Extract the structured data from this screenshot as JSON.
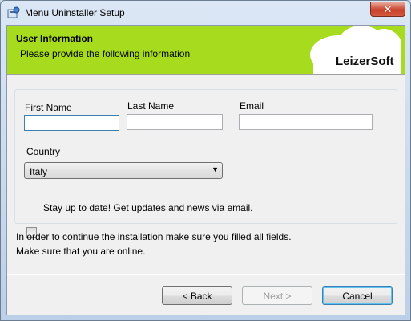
{
  "window": {
    "title": "Menu Uninstaller Setup",
    "close_glyph": "✕"
  },
  "banner": {
    "title": "User Information",
    "subtitle": "Please provide the following information",
    "logo": "LeizerSoft",
    "background_color": "#a6dc1d"
  },
  "form": {
    "first_name_label": "First Name",
    "first_name_value": "",
    "last_name_label": "Last Name",
    "last_name_value": "",
    "email_label": "Email",
    "email_value": "",
    "country_label": "Country",
    "country_selected": "Italy",
    "newsletter_label": "Stay up to date! Get updates and news via email.",
    "newsletter_checked": false
  },
  "notes": {
    "line1": "In order to continue the installation make sure you filled all fields.",
    "line2": "Make sure that you are online."
  },
  "buttons": {
    "back_label": "< Back",
    "next_label": "Next >",
    "cancel_label": "Cancel"
  }
}
